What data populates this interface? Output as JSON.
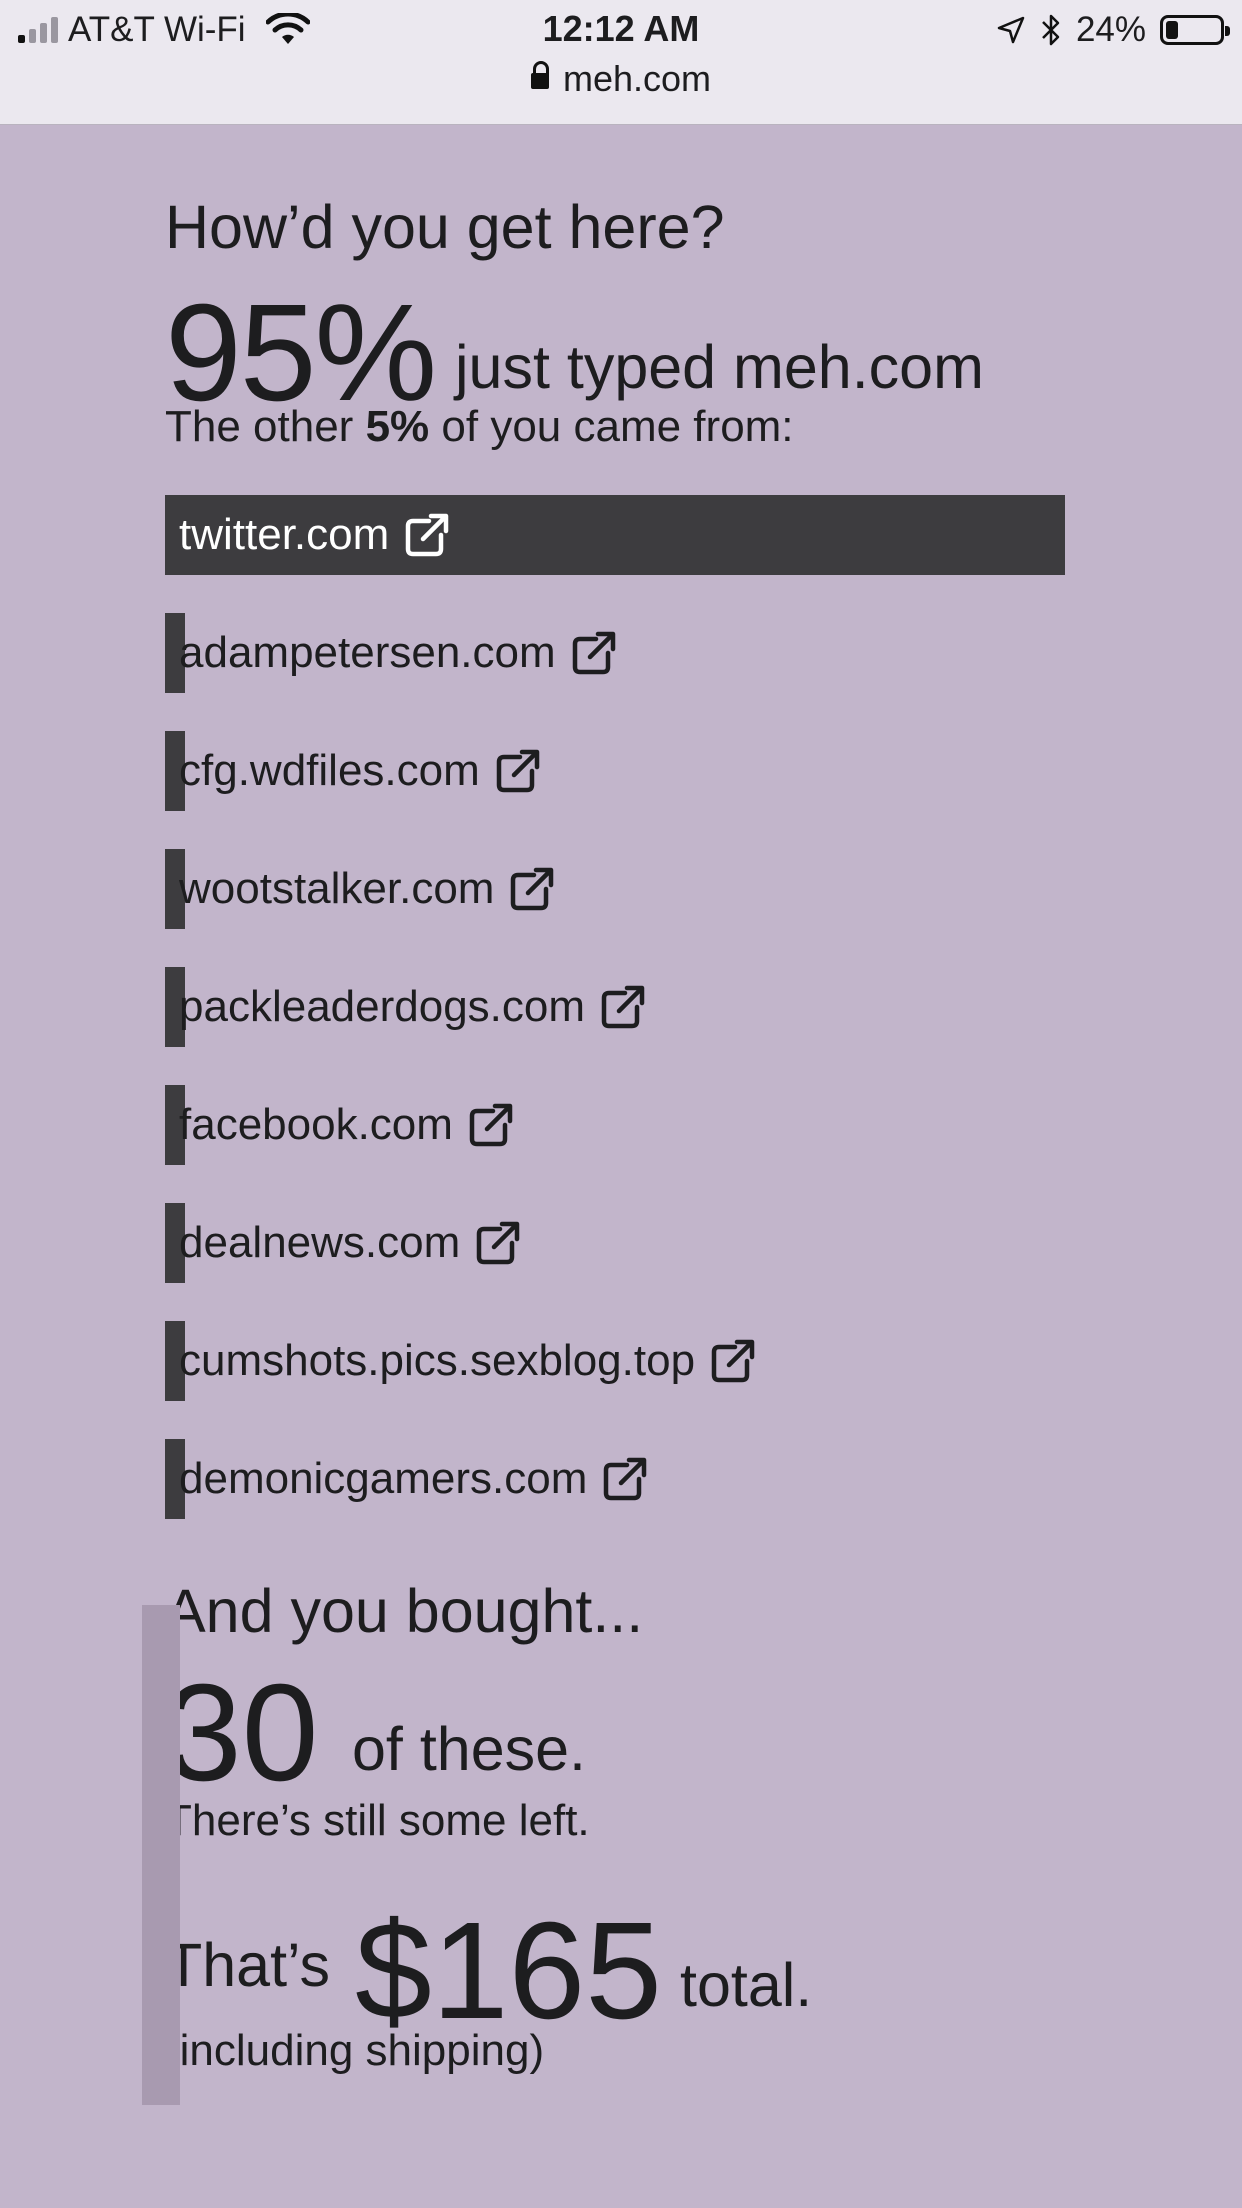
{
  "status_bar": {
    "carrier": "AT&T Wi-Fi",
    "time": "12:12 AM",
    "battery": "24%",
    "battery_level": 0.24,
    "icons": [
      "signal-icon",
      "wifi-icon",
      "location-arrow-icon",
      "bluetooth-icon",
      "battery-icon"
    ]
  },
  "browser": {
    "url": "meh.com"
  },
  "referrals": {
    "heading": "How’d you get here?",
    "big_percent": "95%",
    "big_percent_suffix": "just typed meh.com",
    "other_prefix": "The other",
    "other_percent": "5%",
    "other_suffix": "of you came from:",
    "sites": [
      {
        "label": "twitter.com",
        "share": 1.0
      },
      {
        "label": "adampetersen.com",
        "share": 0.02
      },
      {
        "label": "cfg.wdfiles.com",
        "share": 0.02
      },
      {
        "label": "wootstalker.com",
        "share": 0.02
      },
      {
        "label": "packleaderdogs.com",
        "share": 0.02
      },
      {
        "label": "facebook.com",
        "share": 0.02
      },
      {
        "label": "dealnews.com",
        "share": 0.02
      },
      {
        "label": "cumshots.pics.sexblog.top",
        "share": 0.02
      },
      {
        "label": "demonicgamers.com",
        "share": 0.02
      }
    ]
  },
  "purchases": {
    "heading": "And you bought...",
    "count": "30",
    "count_suffix": "of these.",
    "remaining_text": "There’s still some left.",
    "total_prefix": "That’s",
    "total_amount": "$165",
    "total_suffix": "total.",
    "shipping_note": "(including shipping)"
  },
  "colors": {
    "page_background": "#c2b5cb",
    "bar_dark": "#3d3c3f",
    "bar_light": "#a89ab0"
  }
}
